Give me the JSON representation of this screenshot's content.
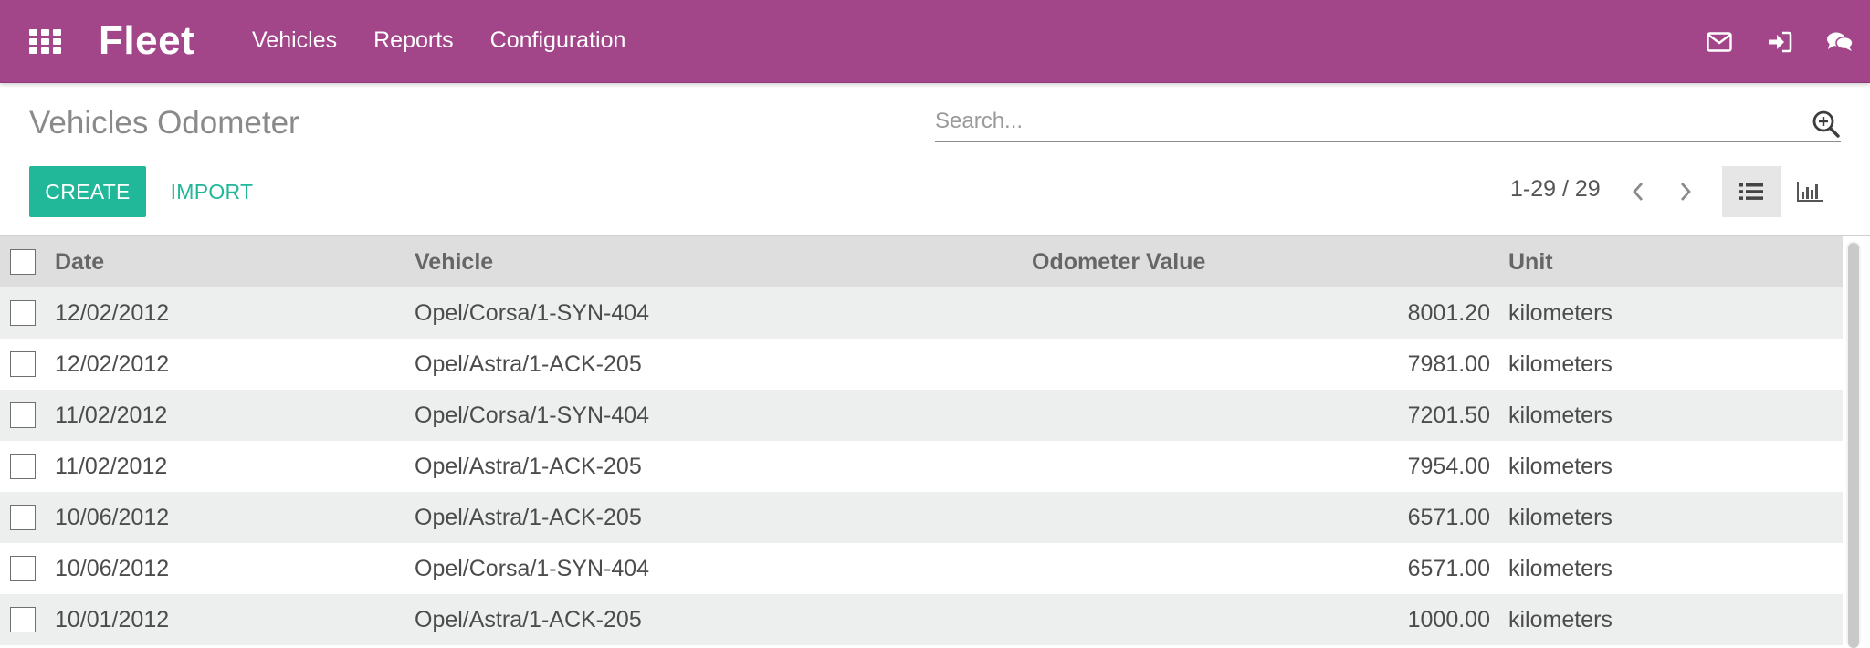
{
  "app": {
    "brand": "Fleet",
    "menu": [
      {
        "label": "Vehicles"
      },
      {
        "label": "Reports"
      },
      {
        "label": "Configuration"
      }
    ],
    "right_icons": [
      "mail-icon",
      "sign-in-icon",
      "chat-icon"
    ],
    "brand_color": "#a24689"
  },
  "control_panel": {
    "title": "Vehicles Odometer",
    "search_placeholder": "Search...",
    "create_label": "CREATE",
    "import_label": "IMPORT",
    "pager": "1-29 / 29",
    "accent_color": "#21b799"
  },
  "table": {
    "columns": [
      "Date",
      "Vehicle",
      "Odometer Value",
      "Unit"
    ],
    "rows": [
      {
        "date": "12/02/2012",
        "vehicle": "Opel/Corsa/1-SYN-404",
        "value": "8001.20",
        "unit": "kilometers"
      },
      {
        "date": "12/02/2012",
        "vehicle": "Opel/Astra/1-ACK-205",
        "value": "7981.00",
        "unit": "kilometers"
      },
      {
        "date": "11/02/2012",
        "vehicle": "Opel/Corsa/1-SYN-404",
        "value": "7201.50",
        "unit": "kilometers"
      },
      {
        "date": "11/02/2012",
        "vehicle": "Opel/Astra/1-ACK-205",
        "value": "7954.00",
        "unit": "kilometers"
      },
      {
        "date": "10/06/2012",
        "vehicle": "Opel/Astra/1-ACK-205",
        "value": "6571.00",
        "unit": "kilometers"
      },
      {
        "date": "10/06/2012",
        "vehicle": "Opel/Corsa/1-SYN-404",
        "value": "6571.00",
        "unit": "kilometers"
      },
      {
        "date": "10/01/2012",
        "vehicle": "Opel/Astra/1-ACK-205",
        "value": "1000.00",
        "unit": "kilometers"
      }
    ]
  }
}
